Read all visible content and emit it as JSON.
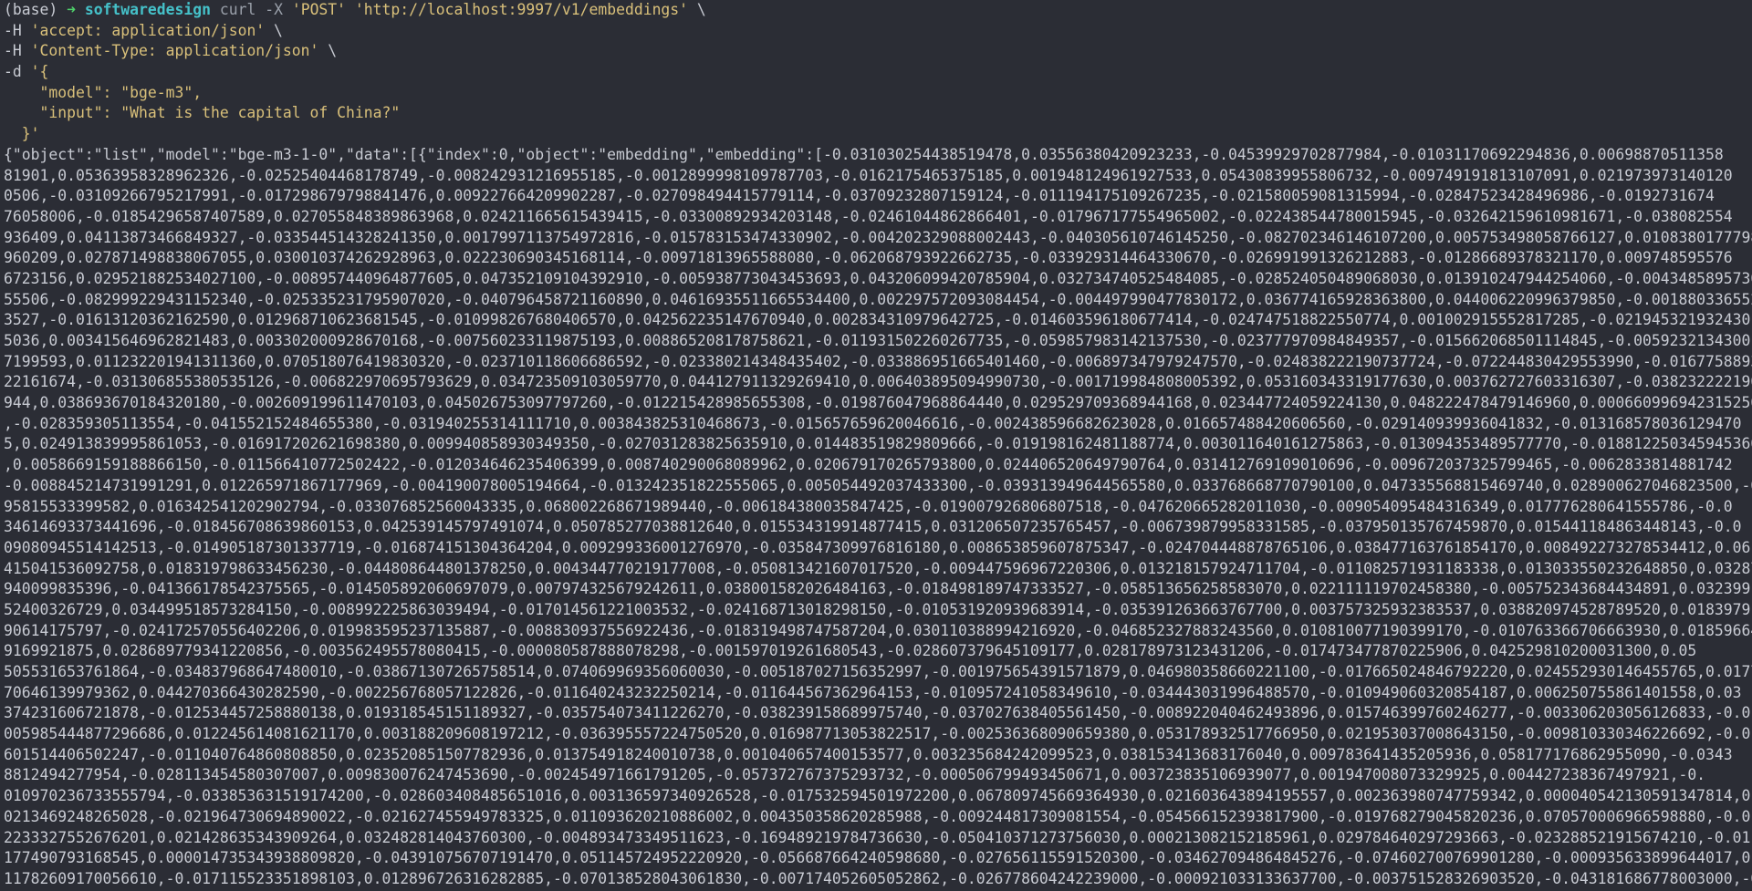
{
  "colors": {
    "background": "#2b2d35",
    "prompt_arrow": "#4fd26b",
    "directory": "#45c1c9",
    "string": "#d9c07a",
    "text": "#c8cbd3"
  },
  "prompt": {
    "env": "(base) ",
    "arrow": "➜",
    "dir": "softwaredesign",
    "cmd": "curl",
    "args": " -X ",
    "method": "'POST'",
    "url": "'http://localhost:9997/v1/embeddings'",
    "cont": " \\"
  },
  "headers": [
    {
      "flag": "-H ",
      "value": "'accept: application/json'",
      "cont": " \\"
    },
    {
      "flag": "-H ",
      "value": "'Content-Type: application/json'",
      "cont": " \\"
    }
  ],
  "data_flag": "-d ",
  "body_lines": [
    "'{",
    "    \"model\": \"bge-m3\",",
    "    \"input\": \"What is the capital of China?\"",
    "  }'"
  ],
  "output_lines": [
    "{\"object\":\"list\",\"model\":\"bge-m3-1-0\",\"data\":[{\"index\":0,\"object\":\"embedding\",\"embedding\":[-0.031030254438519478,0.03556380420923233,-0.04539929702877984,-0.01031170692294836,0.00698870511358",
    "81901,0.05363958328962326,-0.02525404468178749,-0.008242931216955185,-0.0012899998109787703,-0.0162175465375185,0.001948124961927533,0.05430839955806732,-0.009749191813107091,0.021973973140120",
    "0506,-0.03109266795217991,-0.017298679798841476,0.009227664209902287,-0.027098494415779114,-0.03709232807159124,-0.011194175109267235,-0.021580059081315994,-0.02847523428496986,-0.0192731674",
    "76058006,-0.01854296587407589,0.027055848389863968,0.024211665615439415,-0.03300892934203148,-0.02461044862866401,-0.017967177554965002,-0.022438544780015945,-0.032642159610981671,-0.038082554",
    "936409,0.04113873466849327,-0.033544514328241350,0.0017997113754972816,-0.015783153474330902,-0.004202329088002443,-0.040305610746145250,-0.082702346146107200,0.005753498058766127,0.0108380177798",
    "960209,0.027871498838067055,0.030010374262928963,0.022230690345168114,-0.00971813965588080,-0.062068793922662735,-0.033929314464330670,-0.026991991326212883,-0.01286689378321170,0.009748595576",
    "6723156,0.029521882534027100,-0.008957440964877605,0.047352109104392910,-0.005938773043453693,0.043206099420785904,0.032734740525484085,-0.028524050489068030,0.013910247944254060,-0.0043485895730",
    "55506,-0.082999229431152340,-0.025335231795907020,-0.040796458721160890,0.04616935511665534400,0.002297572093084454,-0.004497990477830172,0.036774165928363800,0.044006220996379850,-0.0018803365528580",
    "3527,-0.01613120362162590,0.012968710623681545,-0.010998267680406570,0.042562235147670940,0.002834310979642725,-0.014603596180677414,-0.024747518822550774,0.001002915552817285,-0.021945321932430",
    "5036,0.003415646962821483,0.003302000928670168,-0.007560233119875193,0.008865208178758621,-0.011931502260267735,-0.059857983142137530,-0.023777970984849357,-0.015662068501114845,-0.0059232134300",
    "7199593,0.011232201941311360,0.070518076419830320,-0.023710118606686592,-0.023380214348435402,-0.033886951665401460,-0.006897347979247570,-0.024838222190737724,-0.072244830429553990,-0.0167758893",
    "22161674,-0.031306855380535126,-0.006822970695793629,0.034723509103059770,0.044127911329269410,0.006403895094990730,-0.001719984808005392,0.053160343319177630,0.003762727603316307,-0.038232222190",
    "944,0.038693670184320180,-0.002609199611470103,0.045026753097797260,-0.012215428985655308,-0.019876047968864440,0.029529709368944168,0.023447724059224130,0.048222478479146960,0.000660996942315250",
    ",-0.028359305113554,-0.041552152484655380,-0.031940255314111710,0.003843825310468673,-0.015657659620046616,-0.002438596682623028,0.016657488420606560,-0.029140939936041832,-0.013168578036129470",
    "5,0.024913839995861053,-0.016917202621698380,0.009940858930349350,-0.027031283825635910,0.014483519829809666,-0.019198162481188774,0.003011640161275863,-0.013094353489577770,-0.018812250345945360",
    ",0.0058669159188866150,-0.011566410772502422,-0.012034646235406399,0.008740290068089962,0.020679170265793800,0.024406520649790764,0.031412769109010696,-0.009672037325799465,-0.0062833814881742",
    "-0.008845214731991291,0.012265971867177969,-0.004190078005194664,-0.013242351822555065,0.005054492037433300,-0.039313949644565580,0.033768668770790100,0.047335568815469740,0.028900627046823500,-0.031",
    "95815533399582,0.016342541202902794,-0.033076852560043335,0.068002268671989440,-0.006184380035847425,-0.019007926806807518,-0.047620665282011030,-0.009054095484316349,0.017776280641555786,-0.0",
    "34614693373441696,-0.018456708639860153,0.042539145797491074,0.050785277038812640,0.015534319914877415,0.031206507235765457,-0.006739879958331585,-0.037950135767459870,0.015441184863448143,-0.0",
    "09080945514142513,-0.014905187301337719,-0.016874151304364204,0.009299336001276970,-0.035847309976816180,0.008653859607875347,-0.024704448878765106,0.038477163761854170,0.008492273278534412,0.06",
    "415041536092758,0.018319798633456230,-0.044808644801378250,0.004344770219177008,-0.050813421607017520,-0.009447596967220306,0.013218157924711704,-0.011082571931183338,0.013033550232648850,0.03287",
    "940099835396,-0.041366178542375565,-0.014505892060697079,0.007974325679242611,0.038001582026484163,-0.018498189747333527,-0.058513656258583070,0.022111119702458380,-0.005752343684434891,0.032399",
    "52400326729,0.034499518573284150,-0.008992225863039494,-0.017014561221003532,-0.024168713018298150,-0.010531920939683914,-0.035391263663767700,0.003757325932383537,0.038820974528789520,0.0183979",
    "90614175797,-0.024172570556402206,0.019983595237135887,-0.008830937556922436,-0.018319498747587204,0.030110388994216920,-0.046852327883243560,0.010810077190399170,-0.010763366706663930,0.018596640",
    "9169921875,0.028689779341220856,-0.003562495578080415,-0.000080587888078298,-0.001597019261680543,-0.028607379645109177,0.028178973123431206,-0.017473477870225906,0.042529810200031300,0.05",
    "505531653761864,-0.034837968647480010,-0.038671307265758514,0.074069969356060030,-0.005187027156352997,-0.001975654391571879,0.046980358660221100,-0.017665024846792220,0.024552930146455765,0.0177",
    "70646139979362,0.044270366430282590,-0.002256768057122826,-0.011640243232250214,-0.011644567362964153,-0.010957241058349610,-0.034443031996488570,-0.010949060320854187,0.006250755861401558,0.03",
    "374231606721878,-0.012534457258880138,0.019318545151189327,-0.035754073411226270,-0.038239158689975740,-0.037027638405561450,-0.008922040462493896,0.015746399760246277,-0.003306203056126833,-0.0",
    "005985444877296686,0.012245614081621170,0.003188209608197212,-0.036395557224750520,0.016987713053822517,-0.002536368090659380,0.053178932517766950,0.021953037008643150,-0.009810330346226692,-0.01",
    "601514406502247,-0.011040764860808850,0.023520851507782936,0.013754918240010738,0.001040657400153577,0.003235684242099523,0.038153413683176040,0.009783641435205936,0.058177176862955090,-0.0343",
    "8812494277954,-0.028113454580307007,0.009830076247453690,-0.002454971661791205,-0.057372767375293732,-0.000506799493450671,0.003723835106939077,0.001947008073329925,0.004427238367497921,-0.",
    "010970236733555794,-0.033853631519174200,-0.028603408485651016,0.003136597340926528,-0.017532594501972200,0.067809745669364930,0.021603643894195557,0.002363980747759342,0.000040542130591347814,0.",
    "0213469248265028,-0.021964730694890022,-0.021627455949783325,0.011093620210886002,0.004350358620285988,-0.009244817309081554,-0.054566152393817900,-0.019768279045820236,0.070570006966598880,-0.0",
    "2233327552676201,0.021428635343909264,0.032482814043760300,-0.004893473349511623,-0.169489219784736630,-0.050410371273756030,0.000213082152185961,0.029784640297293663,-0.023288521915674210,-0.01",
    "177490793168545,0.000014735343938809820,-0.043910756707191470,0.051145724952220920,-0.056687664240598680,-0.027656115591520300,-0.034627094864845276,-0.074602700769901280,-0.000935633899644017,0.0",
    "11782609170056610,-0.017115523351898103,0.012896726316282885,-0.070138528043061830,-0.007174052605052862,-0.026778604242239000,-0.000921033133637700,-0.003751528326903520,-0.043181686778003000,-0.0"
  ]
}
